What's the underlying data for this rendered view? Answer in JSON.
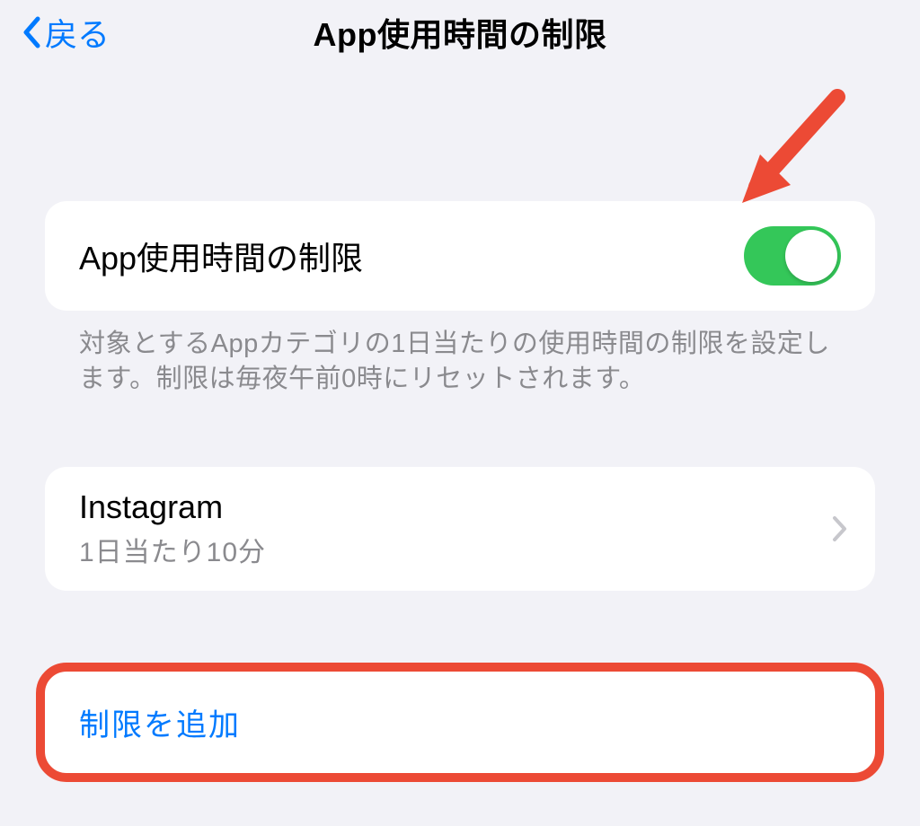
{
  "header": {
    "back_label": "戻る",
    "title": "App使用時間の制限"
  },
  "toggle_section": {
    "label": "App使用時間の制限",
    "on": true,
    "footer": "対象とするAppカテゴリの1日当たりの使用時間の制限を設定します。制限は毎夜午前0時にリセットされます。"
  },
  "limits": [
    {
      "name": "Instagram",
      "detail": "1日当たり10分"
    }
  ],
  "add_limit_label": "制限を追加",
  "colors": {
    "accent": "#007aff",
    "toggle_on": "#34c759",
    "annotation": "#ec4a35",
    "background": "#f2f2f7"
  }
}
